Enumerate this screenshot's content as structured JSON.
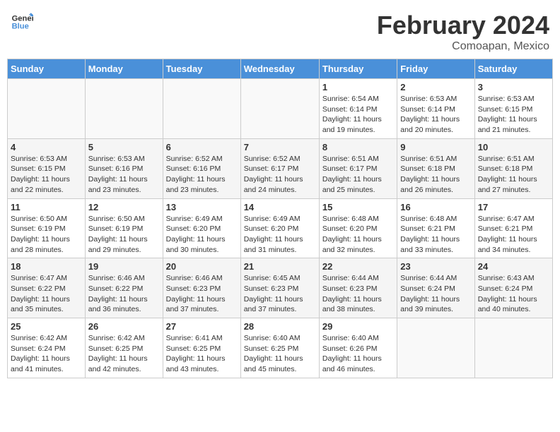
{
  "header": {
    "logo_line1": "General",
    "logo_line2": "Blue",
    "month_title": "February 2024",
    "subtitle": "Comoapan, Mexico"
  },
  "calendar": {
    "days_of_week": [
      "Sunday",
      "Monday",
      "Tuesday",
      "Wednesday",
      "Thursday",
      "Friday",
      "Saturday"
    ],
    "weeks": [
      [
        {
          "day": "",
          "info": ""
        },
        {
          "day": "",
          "info": ""
        },
        {
          "day": "",
          "info": ""
        },
        {
          "day": "",
          "info": ""
        },
        {
          "day": "1",
          "info": "Sunrise: 6:54 AM\nSunset: 6:14 PM\nDaylight: 11 hours and 19 minutes."
        },
        {
          "day": "2",
          "info": "Sunrise: 6:53 AM\nSunset: 6:14 PM\nDaylight: 11 hours and 20 minutes."
        },
        {
          "day": "3",
          "info": "Sunrise: 6:53 AM\nSunset: 6:15 PM\nDaylight: 11 hours and 21 minutes."
        }
      ],
      [
        {
          "day": "4",
          "info": "Sunrise: 6:53 AM\nSunset: 6:15 PM\nDaylight: 11 hours and 22 minutes."
        },
        {
          "day": "5",
          "info": "Sunrise: 6:53 AM\nSunset: 6:16 PM\nDaylight: 11 hours and 23 minutes."
        },
        {
          "day": "6",
          "info": "Sunrise: 6:52 AM\nSunset: 6:16 PM\nDaylight: 11 hours and 23 minutes."
        },
        {
          "day": "7",
          "info": "Sunrise: 6:52 AM\nSunset: 6:17 PM\nDaylight: 11 hours and 24 minutes."
        },
        {
          "day": "8",
          "info": "Sunrise: 6:51 AM\nSunset: 6:17 PM\nDaylight: 11 hours and 25 minutes."
        },
        {
          "day": "9",
          "info": "Sunrise: 6:51 AM\nSunset: 6:18 PM\nDaylight: 11 hours and 26 minutes."
        },
        {
          "day": "10",
          "info": "Sunrise: 6:51 AM\nSunset: 6:18 PM\nDaylight: 11 hours and 27 minutes."
        }
      ],
      [
        {
          "day": "11",
          "info": "Sunrise: 6:50 AM\nSunset: 6:19 PM\nDaylight: 11 hours and 28 minutes."
        },
        {
          "day": "12",
          "info": "Sunrise: 6:50 AM\nSunset: 6:19 PM\nDaylight: 11 hours and 29 minutes."
        },
        {
          "day": "13",
          "info": "Sunrise: 6:49 AM\nSunset: 6:20 PM\nDaylight: 11 hours and 30 minutes."
        },
        {
          "day": "14",
          "info": "Sunrise: 6:49 AM\nSunset: 6:20 PM\nDaylight: 11 hours and 31 minutes."
        },
        {
          "day": "15",
          "info": "Sunrise: 6:48 AM\nSunset: 6:20 PM\nDaylight: 11 hours and 32 minutes."
        },
        {
          "day": "16",
          "info": "Sunrise: 6:48 AM\nSunset: 6:21 PM\nDaylight: 11 hours and 33 minutes."
        },
        {
          "day": "17",
          "info": "Sunrise: 6:47 AM\nSunset: 6:21 PM\nDaylight: 11 hours and 34 minutes."
        }
      ],
      [
        {
          "day": "18",
          "info": "Sunrise: 6:47 AM\nSunset: 6:22 PM\nDaylight: 11 hours and 35 minutes."
        },
        {
          "day": "19",
          "info": "Sunrise: 6:46 AM\nSunset: 6:22 PM\nDaylight: 11 hours and 36 minutes."
        },
        {
          "day": "20",
          "info": "Sunrise: 6:46 AM\nSunset: 6:23 PM\nDaylight: 11 hours and 37 minutes."
        },
        {
          "day": "21",
          "info": "Sunrise: 6:45 AM\nSunset: 6:23 PM\nDaylight: 11 hours and 37 minutes."
        },
        {
          "day": "22",
          "info": "Sunrise: 6:44 AM\nSunset: 6:23 PM\nDaylight: 11 hours and 38 minutes."
        },
        {
          "day": "23",
          "info": "Sunrise: 6:44 AM\nSunset: 6:24 PM\nDaylight: 11 hours and 39 minutes."
        },
        {
          "day": "24",
          "info": "Sunrise: 6:43 AM\nSunset: 6:24 PM\nDaylight: 11 hours and 40 minutes."
        }
      ],
      [
        {
          "day": "25",
          "info": "Sunrise: 6:42 AM\nSunset: 6:24 PM\nDaylight: 11 hours and 41 minutes."
        },
        {
          "day": "26",
          "info": "Sunrise: 6:42 AM\nSunset: 6:25 PM\nDaylight: 11 hours and 42 minutes."
        },
        {
          "day": "27",
          "info": "Sunrise: 6:41 AM\nSunset: 6:25 PM\nDaylight: 11 hours and 43 minutes."
        },
        {
          "day": "28",
          "info": "Sunrise: 6:40 AM\nSunset: 6:25 PM\nDaylight: 11 hours and 45 minutes."
        },
        {
          "day": "29",
          "info": "Sunrise: 6:40 AM\nSunset: 6:26 PM\nDaylight: 11 hours and 46 minutes."
        },
        {
          "day": "",
          "info": ""
        },
        {
          "day": "",
          "info": ""
        }
      ]
    ]
  }
}
